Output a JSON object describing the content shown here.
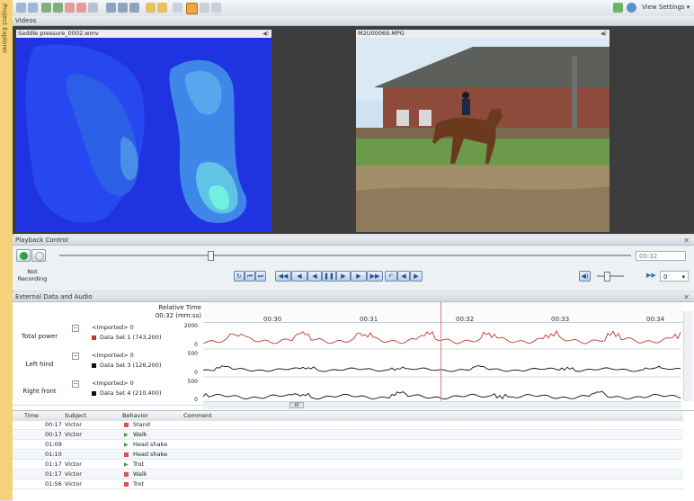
{
  "toolbar": {
    "view_settings_label": "View Settings"
  },
  "sidebar": {
    "label": "Project Explorer"
  },
  "videos_panel": {
    "title": "Videos",
    "left_video": {
      "title": "Saddle pressure_0002.wmv"
    },
    "right_video": {
      "title": "M2U00069.MPG"
    }
  },
  "playback": {
    "title": "Playback Control",
    "not_recording_line1": "Not",
    "not_recording_line2": "Recording",
    "time_value": "00:32",
    "speed_value": "0",
    "progress_fraction": 0.26
  },
  "external": {
    "title": "External Data and Audio",
    "relative_time_label": "Relative Time",
    "current_time_label": "00:32 (mm:ss)",
    "ticks": [
      "00:30",
      "00:31",
      "00:32",
      "00:33",
      "00:34"
    ],
    "tracks": [
      {
        "name": "Total power",
        "group": "<Imported> 0",
        "dataset": "Data Set 1  (743,200)",
        "ymax": "2000",
        "ymin": "0",
        "color": "#c0392b"
      },
      {
        "name": "Left hind",
        "group": "<Imported> 0",
        "dataset": "Data Set 3  (126,200)",
        "ymax": "500",
        "ymin": "0",
        "color": "#111111"
      },
      {
        "name": "Right front",
        "group": "<Imported> 0",
        "dataset": "Data Set 4  (210,400)",
        "ymax": "500",
        "ymin": "0",
        "color": "#111111"
      }
    ],
    "scroll_label": "III"
  },
  "events": {
    "headers": {
      "time": "Time",
      "subject": "Subject",
      "behavior": "Behavior",
      "comment": "Comment"
    },
    "rows": [
      {
        "time": "00:17",
        "subject": "Victor",
        "behavior": "Stand",
        "kind": "state",
        "color": "#d9534f"
      },
      {
        "time": "00:17",
        "subject": "Victor",
        "behavior": "Walk",
        "kind": "start",
        "color": "#3c9a3c"
      },
      {
        "time": "01:09",
        "subject": "",
        "behavior": "Head shake",
        "kind": "start",
        "color": "#3c9a3c"
      },
      {
        "time": "01:10",
        "subject": "",
        "behavior": "Head shake",
        "kind": "state",
        "color": "#d9534f"
      },
      {
        "time": "01:17",
        "subject": "Victor",
        "behavior": "Trot",
        "kind": "start",
        "color": "#3c9a3c"
      },
      {
        "time": "01:17",
        "subject": "Victor",
        "behavior": "Walk",
        "kind": "state",
        "color": "#d9534f"
      },
      {
        "time": "01:56",
        "subject": "Victor",
        "behavior": "Trot",
        "kind": "state",
        "color": "#d9534f"
      }
    ]
  }
}
